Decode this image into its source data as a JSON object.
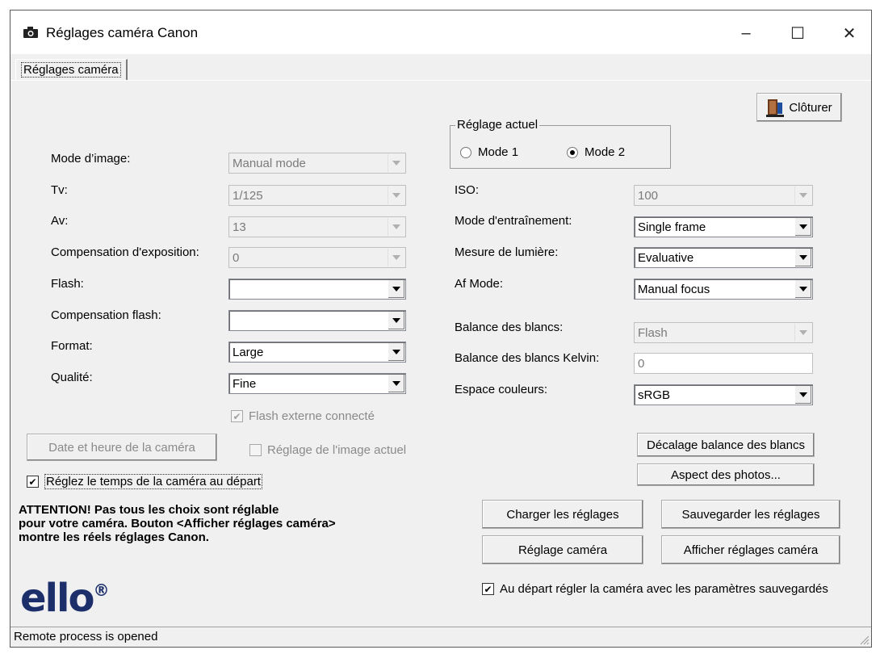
{
  "window": {
    "title": "Réglages caméra Canon",
    "minimize": "–",
    "maximize": "☐",
    "close": "✕"
  },
  "tab": {
    "label": "Réglages caméra"
  },
  "close_button": {
    "label": "Clôturer"
  },
  "current_setting": {
    "title": "Réglage actuel",
    "mode1": "Mode 1",
    "mode2": "Mode 2",
    "selected": "Mode 2"
  },
  "left": {
    "mode_image": {
      "label": "Mode d’image:",
      "value": "Manual mode"
    },
    "tv": {
      "label": "Tv:",
      "value": "1/125"
    },
    "av": {
      "label": "Av:",
      "value": "13"
    },
    "exposure_comp": {
      "label": "Compensation d'exposition:",
      "value": "0"
    },
    "flash": {
      "label": "Flash:",
      "value": ""
    },
    "flash_comp": {
      "label": "Compensation flash:",
      "value": ""
    },
    "format": {
      "label": "Format:",
      "value": "Large"
    },
    "quality": {
      "label": "Qualité:",
      "value": "Fine"
    },
    "external_flash": {
      "label": "Flash externe connecté",
      "checked": true
    },
    "date_button": "Date et heure de la caméra",
    "current_image": {
      "label": "Réglage de l'image actuel",
      "checked": false
    },
    "set_time": {
      "label": "Réglez le temps de la caméra au départ",
      "checked": true
    }
  },
  "right": {
    "iso": {
      "label": "ISO:",
      "value": "100"
    },
    "drive_mode": {
      "label": "Mode d'entraînement:",
      "value": "Single frame"
    },
    "metering": {
      "label": "Mesure de lumière:",
      "value": "Evaluative"
    },
    "af_mode": {
      "label": "Af Mode:",
      "value": "Manual focus"
    },
    "white_balance": {
      "label": "Balance des blancs:",
      "value": "Flash"
    },
    "wb_kelvin": {
      "label": "Balance des blancs Kelvin:",
      "value": "0"
    },
    "color_space": {
      "label": "Espace couleurs:",
      "value": "sRGB"
    },
    "wb_shift_button": "Décalage balance des blancs",
    "picture_style_button": "Aspect des photos..."
  },
  "warning": {
    "line1": "ATTENTION! Pas tous les choix sont réglable",
    "line2": "pour votre caméra. Bouton <Afficher réglages caméra>",
    "line3": "montre les réels réglages Canon."
  },
  "actions": {
    "load": "Charger les réglages",
    "save": "Sauvegarder les réglages",
    "set_camera": "Réglage caméra",
    "show_camera": "Afficher réglages caméra",
    "apply_at_start": {
      "label": "Au départ régler la caméra avec les paramètres sauvegardés",
      "checked": true
    }
  },
  "logo": {
    "text": "ello",
    "mark": "®"
  },
  "status": {
    "text": "Remote process is opened"
  },
  "colors": {
    "logo": "#1c2f6b",
    "face": "#f0f0f0"
  }
}
